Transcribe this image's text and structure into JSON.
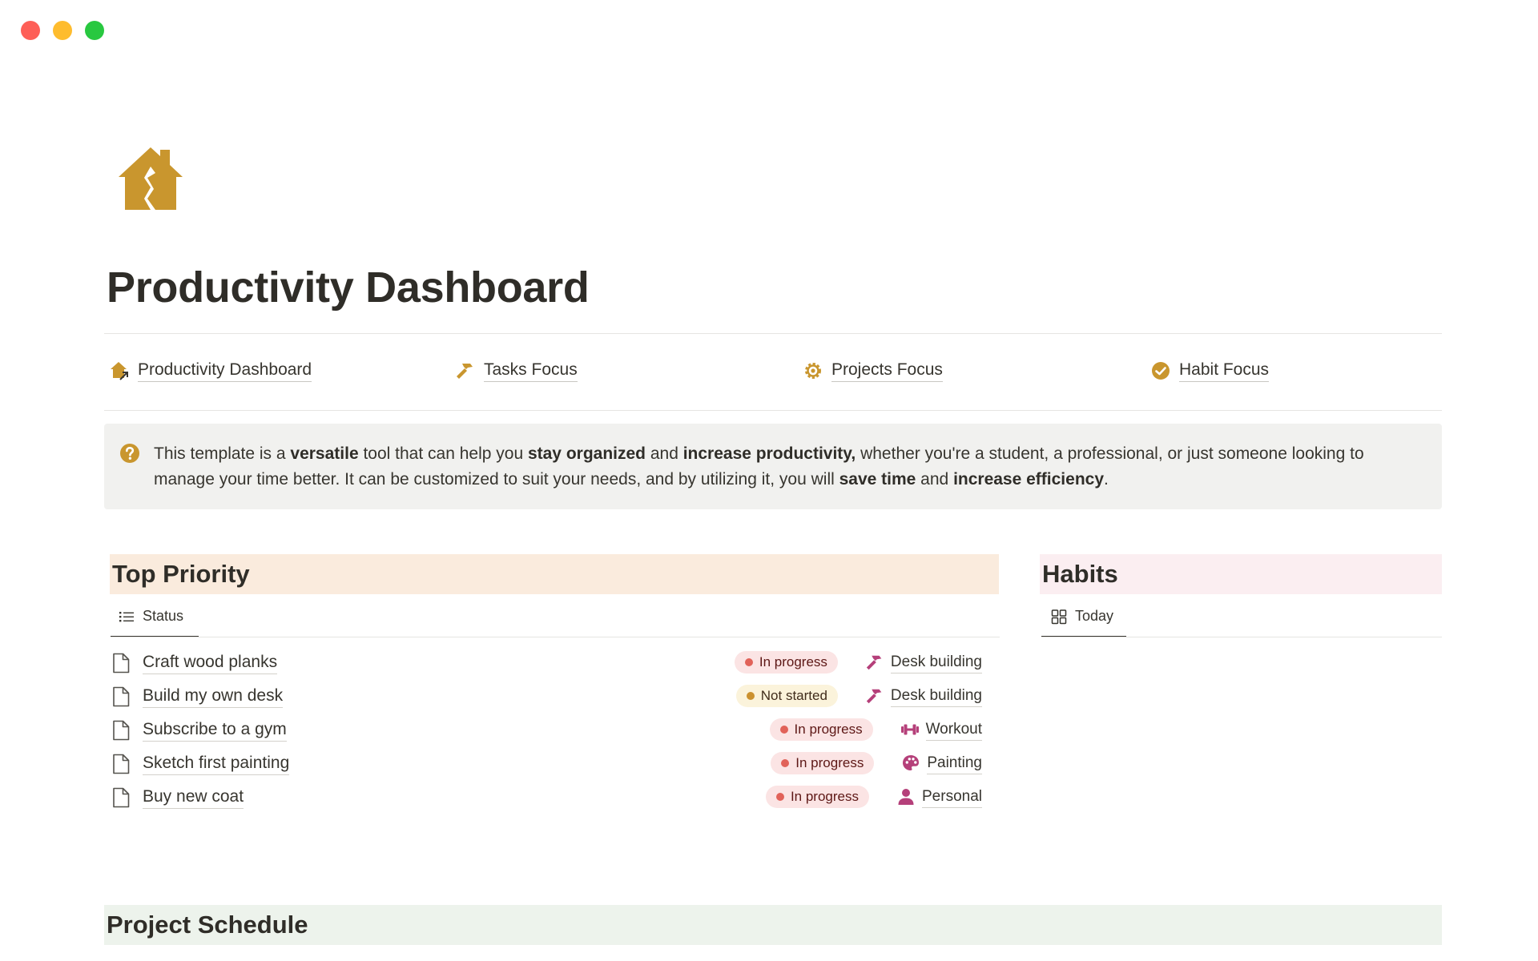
{
  "window": {
    "buttons": [
      "close",
      "minimize",
      "maximize"
    ]
  },
  "page": {
    "icon": "house-icon",
    "title": "Productivity Dashboard"
  },
  "nav": {
    "items": [
      {
        "label": "Productivity Dashboard",
        "icon": "house-link-icon"
      },
      {
        "label": "Tasks Focus",
        "icon": "hammer-icon"
      },
      {
        "label": "Projects Focus",
        "icon": "gear-icon"
      },
      {
        "label": "Habit Focus",
        "icon": "check-circle-icon"
      }
    ]
  },
  "callout": {
    "icon": "question-circle-icon",
    "segments": [
      {
        "text": "This template is a ",
        "bold": false
      },
      {
        "text": "versatile",
        "bold": true
      },
      {
        "text": " tool that can help you ",
        "bold": false
      },
      {
        "text": "stay organized",
        "bold": true
      },
      {
        "text": " and ",
        "bold": false
      },
      {
        "text": "increase productivity,",
        "bold": true
      },
      {
        "text": " whether you're a student, a professional, or just someone looking to manage your time better. It can be customized to suit your needs, and by utilizing it, you will ",
        "bold": false
      },
      {
        "text": "save time",
        "bold": true
      },
      {
        "text": " and ",
        "bold": false
      },
      {
        "text": "increase efficiency",
        "bold": true
      },
      {
        "text": ".",
        "bold": false
      }
    ]
  },
  "top_priority": {
    "title": "Top Priority",
    "header_color": "#faebdd",
    "view_tab": {
      "label": "Status",
      "icon": "list-icon"
    },
    "tasks": [
      {
        "name": "Craft wood planks",
        "status": "In progress",
        "project": "Desk building",
        "project_icon": "hammer-icon"
      },
      {
        "name": "Build my own desk",
        "status": "Not started",
        "project": "Desk building",
        "project_icon": "hammer-icon"
      },
      {
        "name": "Subscribe to a gym",
        "status": "In progress",
        "project": "Workout",
        "project_icon": "dumbbell-icon"
      },
      {
        "name": "Sketch first painting",
        "status": "In progress",
        "project": "Painting",
        "project_icon": "palette-icon"
      },
      {
        "name": "Buy new coat",
        "status": "In progress",
        "project": "Personal",
        "project_icon": "person-icon"
      }
    ],
    "status_colors": {
      "In progress": {
        "bg": "#fbe4e4",
        "dot": "#e16259",
        "text": "#5d1715"
      },
      "Not started": {
        "bg": "#fbf3db",
        "dot": "#cb912f",
        "text": "#402c1b"
      }
    }
  },
  "habits": {
    "title": "Habits",
    "header_color": "#fbeef1",
    "view_tab": {
      "label": "Today",
      "icon": "gallery-grid-icon"
    }
  },
  "project_schedule": {
    "title": "Project Schedule",
    "header_color": "#edf3ec"
  },
  "colors": {
    "accent_gold": "#c9962e",
    "project_pink": "#b5407a"
  }
}
